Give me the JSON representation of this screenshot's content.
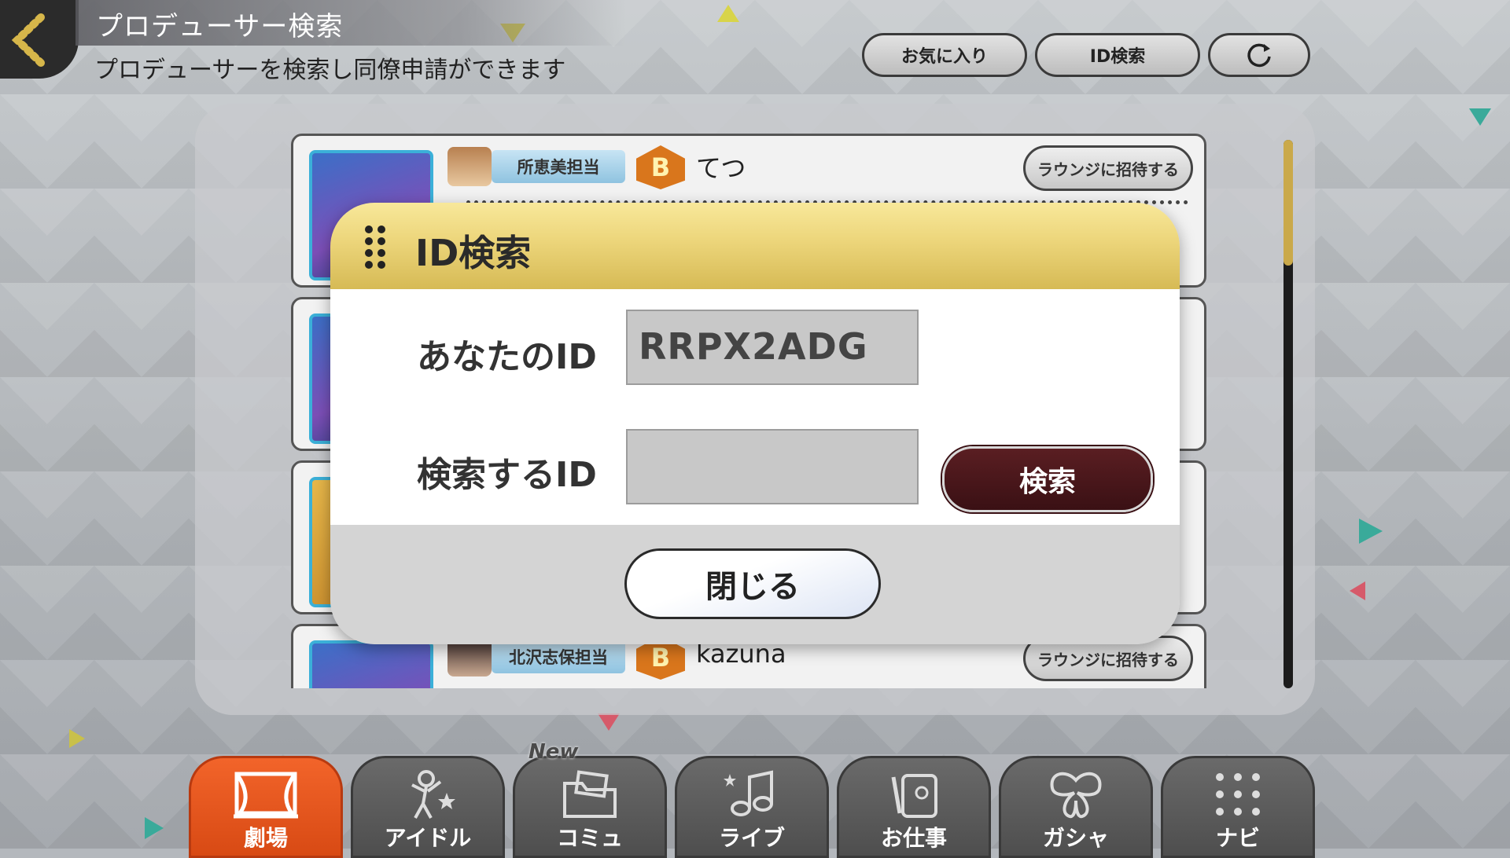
{
  "header": {
    "title": "プロデューサー検索",
    "subtitle": "プロデューサーを検索し同僚申請ができます",
    "back_icon": "chevron-left-icon"
  },
  "toolbar": {
    "favorites_label": "お気に入り",
    "id_search_label": "ID検索",
    "refresh_icon": "refresh-icon"
  },
  "list": {
    "rows": [
      {
        "tag": "所恵美担当",
        "rank": "B",
        "name": "てつ",
        "invite": "ラウンジに招待する"
      },
      {
        "tag": "",
        "rank": "",
        "name": "",
        "invite": ""
      },
      {
        "tag": "",
        "rank": "",
        "name": "",
        "invite": ""
      },
      {
        "tag": "北沢志保担当",
        "rank": "B",
        "name": "kazuna",
        "invite": "ラウンジに招待する"
      }
    ]
  },
  "modal": {
    "title": "ID検索",
    "your_id_label": "あなたのID",
    "your_id_value": "RRPX2ADG",
    "search_id_label": "検索するID",
    "search_id_value": "",
    "search_button": "検索",
    "close_button": "閉じる"
  },
  "nav": {
    "tabs": [
      {
        "label": "劇場",
        "icon": "theater-icon",
        "active": true
      },
      {
        "label": "アイドル",
        "icon": "idol-icon",
        "active": false
      },
      {
        "label": "コミュ",
        "icon": "folder-icon",
        "active": false
      },
      {
        "label": "ライブ",
        "icon": "music-note-icon",
        "active": false
      },
      {
        "label": "お仕事",
        "icon": "notebook-icon",
        "active": false
      },
      {
        "label": "ガシャ",
        "icon": "butterfly-icon",
        "active": false
      },
      {
        "label": "ナビ",
        "icon": "grid-dots-icon",
        "active": false
      }
    ],
    "new_badge": "New"
  },
  "colors": {
    "modal_header": "#ecd57a",
    "search_button": "#4a161a",
    "active_tab": "#e8581f",
    "scroll_thumb": "#caa94a"
  }
}
